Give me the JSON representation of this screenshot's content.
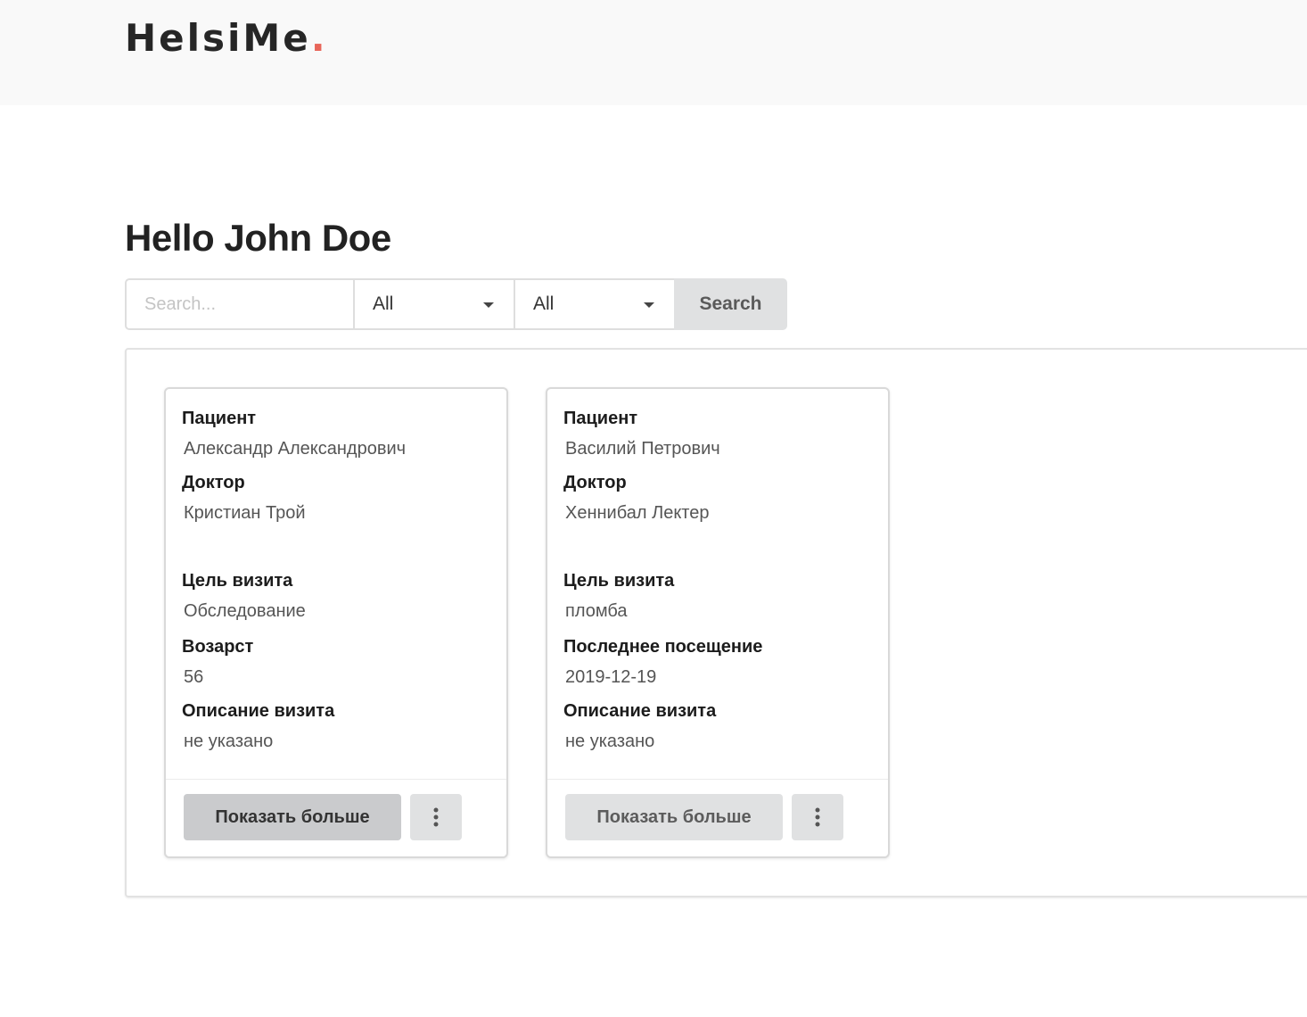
{
  "header": {
    "logo_text": "HelsiMe",
    "logo_dot": ".",
    "logo_dot_color": "#e8665a"
  },
  "greeting": "Hello John Doe",
  "search": {
    "placeholder": "Search...",
    "value": "",
    "filter1_value": "All",
    "filter2_value": "All",
    "button_label": "Search"
  },
  "cards": [
    {
      "fields": [
        {
          "label": "Пациент",
          "value": "Александр Александрович"
        },
        {
          "label": "Доктор",
          "value": "Кристиан Трой"
        },
        {
          "label": "Цель визита",
          "value": "Обследование"
        },
        {
          "label": "Возарст",
          "value": "56"
        },
        {
          "label": "Описание визита",
          "value": "не указано"
        }
      ],
      "more_label": "Показать больше"
    },
    {
      "fields": [
        {
          "label": "Пациент",
          "value": "Василий Петрович"
        },
        {
          "label": "Доктор",
          "value": "Хеннибал Лектер"
        },
        {
          "label": "Цель визита",
          "value": "пломба"
        },
        {
          "label": "Последнее посещение",
          "value": "2019-12-19"
        },
        {
          "label": "Описание визита",
          "value": "не указано"
        }
      ],
      "more_label": "Показать больше"
    }
  ],
  "icons": {
    "filter_caret": "chevron-down-icon",
    "card_menu": "kebab-menu-icon"
  }
}
